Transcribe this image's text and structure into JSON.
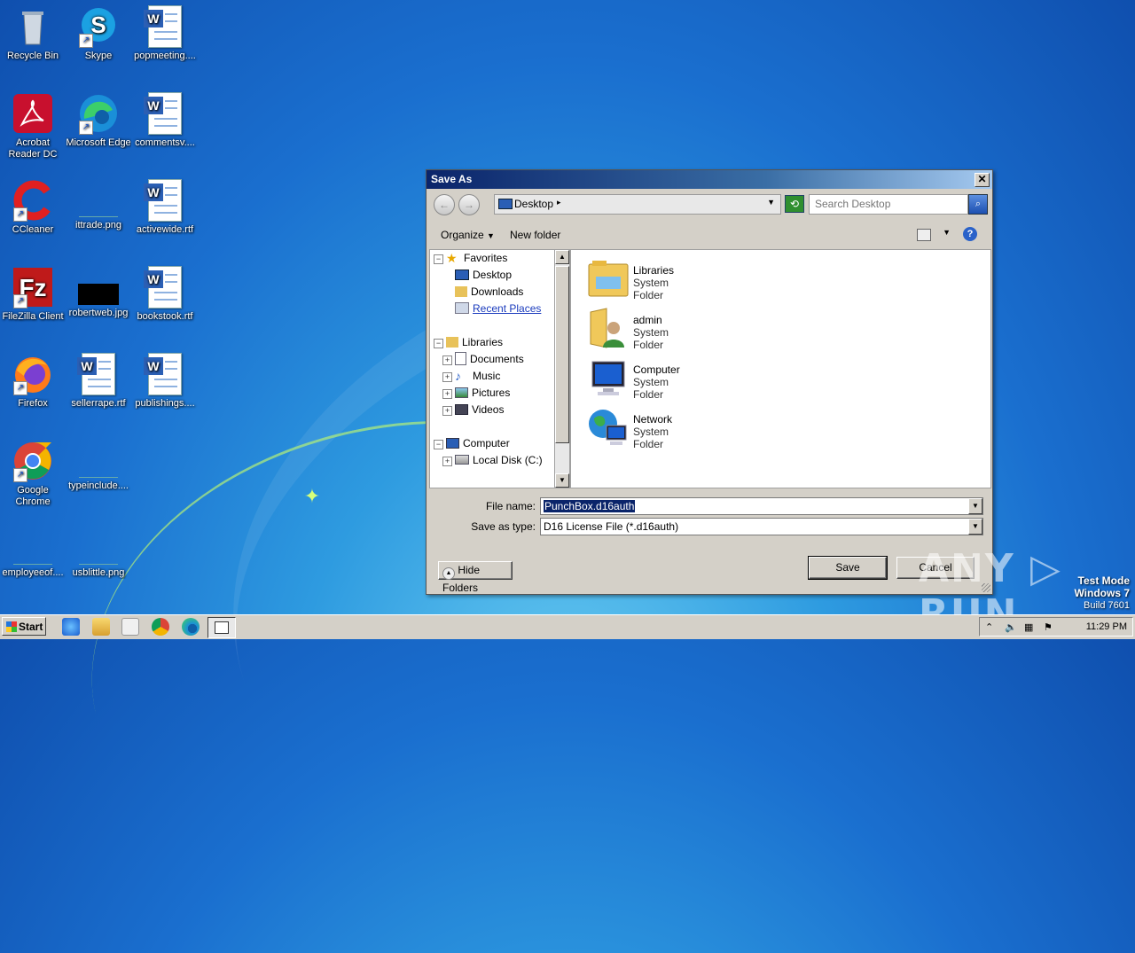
{
  "desktop": {
    "icons": [
      {
        "label": "Recycle Bin",
        "kind": "recycle-bin-icon"
      },
      {
        "label": "Skype",
        "kind": "skype-icon"
      },
      {
        "label": "popmeeting....",
        "kind": "word-document-icon"
      },
      {
        "label": "Acrobat Reader DC",
        "kind": "acrobat-icon"
      },
      {
        "label": "Microsoft Edge",
        "kind": "edge-icon"
      },
      {
        "label": "commentsv....",
        "kind": "word-document-icon"
      },
      {
        "label": "CCleaner",
        "kind": "ccleaner-icon"
      },
      {
        "label": "ittrade.png",
        "kind": "image-file-icon"
      },
      {
        "label": "activewide.rtf",
        "kind": "word-document-icon"
      },
      {
        "label": "FileZilla Client",
        "kind": "filezilla-icon"
      },
      {
        "label": "robertweb.jpg",
        "kind": "image-file-icon"
      },
      {
        "label": "bookstook.rtf",
        "kind": "word-document-icon"
      },
      {
        "label": "Firefox",
        "kind": "firefox-icon"
      },
      {
        "label": "sellerrape.rtf",
        "kind": "word-document-icon"
      },
      {
        "label": "publishings....",
        "kind": "word-document-icon"
      },
      {
        "label": "Google Chrome",
        "kind": "chrome-icon"
      },
      {
        "label": "typeinclude....",
        "kind": "image-file-icon"
      },
      {
        "label": "employeeof....",
        "kind": "image-file-icon"
      },
      {
        "label": "usblittle.png",
        "kind": "image-file-icon"
      }
    ]
  },
  "dialog": {
    "title": "Save As",
    "close": "✕",
    "address": "Desktop",
    "search_placeholder": "Search Desktop",
    "toolbar": {
      "organize": "Organize",
      "new_folder": "New folder"
    },
    "nav": {
      "favorites": "Favorites",
      "desktop": "Desktop",
      "downloads": "Downloads",
      "recent_places": "Recent Places",
      "libraries": "Libraries",
      "documents": "Documents",
      "music": "Music",
      "pictures": "Pictures",
      "videos": "Videos",
      "computer": "Computer",
      "local_disk": "Local Disk (C:)"
    },
    "items": [
      {
        "name": "Libraries",
        "type": "System Folder"
      },
      {
        "name": "admin",
        "type": "System Folder"
      },
      {
        "name": "Computer",
        "type": "System Folder"
      },
      {
        "name": "Network",
        "type": "System Folder"
      }
    ],
    "file_name_label": "File name:",
    "file_name_value": "PunchBox.d16auth",
    "save_type_label": "Save as type:",
    "save_type_value": "D16 License File (*.d16auth)",
    "hide_folders": "Hide Folders",
    "save": "Save",
    "cancel": "Cancel"
  },
  "watermark": "ANY ▷ RUN",
  "test_mode": {
    "line1": "Test Mode",
    "line2": "Windows 7",
    "line3": "Build 7601"
  },
  "taskbar": {
    "start": "Start",
    "time": "11:29 PM"
  }
}
